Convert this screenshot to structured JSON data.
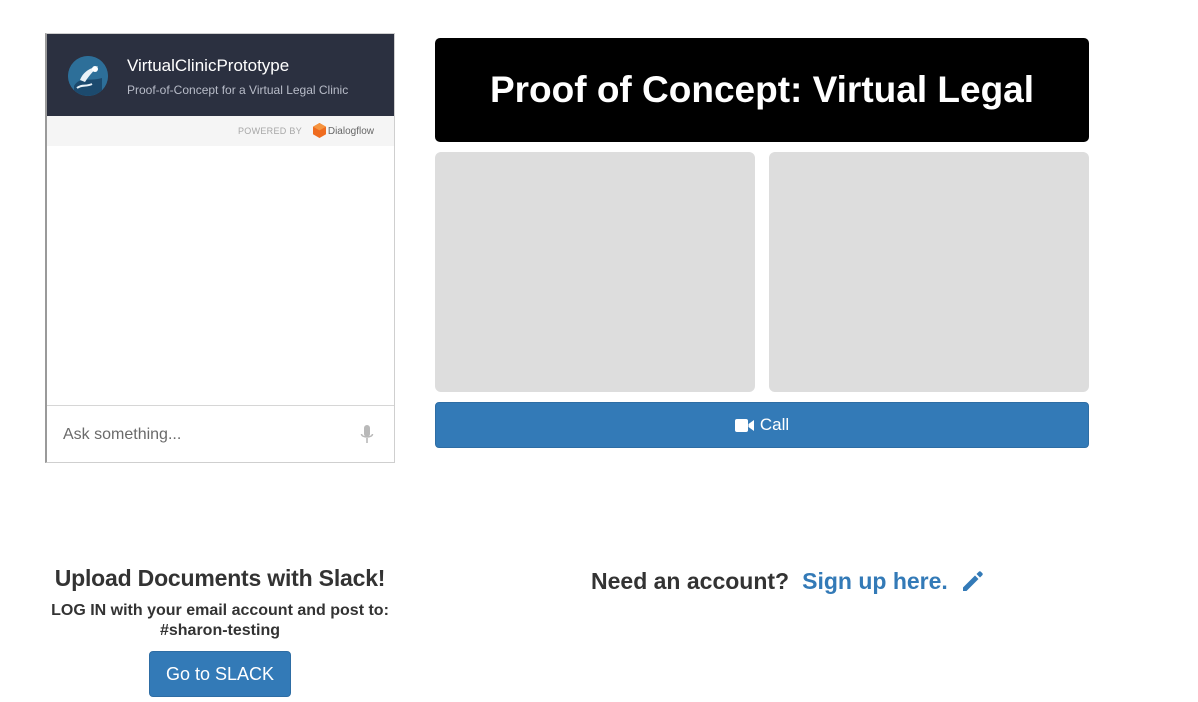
{
  "chat_widget": {
    "title": "VirtualClinicPrototype",
    "subtitle": "Proof-of-Concept for a Virtual Legal Clinic",
    "powered_by": "POWERED BY",
    "provider": "Dialogflow",
    "input_placeholder": "Ask something...",
    "icons": {
      "avatar": "bot-avatar-icon",
      "provider": "dialogflow-logo-icon",
      "mic": "microphone-icon"
    },
    "colors": {
      "header": "#2b3040",
      "provider_logo": "#ef6c1f"
    }
  },
  "main": {
    "title": "Proof of Concept: Virtual Legal Clinic",
    "call_label": "Call",
    "call_icon": "video-camera-icon",
    "colors": {
      "title_bg": "#000000",
      "video_placeholder": "#dddddd",
      "primary": "#337ab7"
    }
  },
  "slack": {
    "heading": "Upload Documents with Slack!",
    "instructions": "LOG IN with your email account and post to: #sharon-testing",
    "button_label": "Go to SLACK"
  },
  "signup": {
    "question": "Need an account?",
    "link_label": "Sign up here.",
    "icon": "pencil-icon"
  }
}
